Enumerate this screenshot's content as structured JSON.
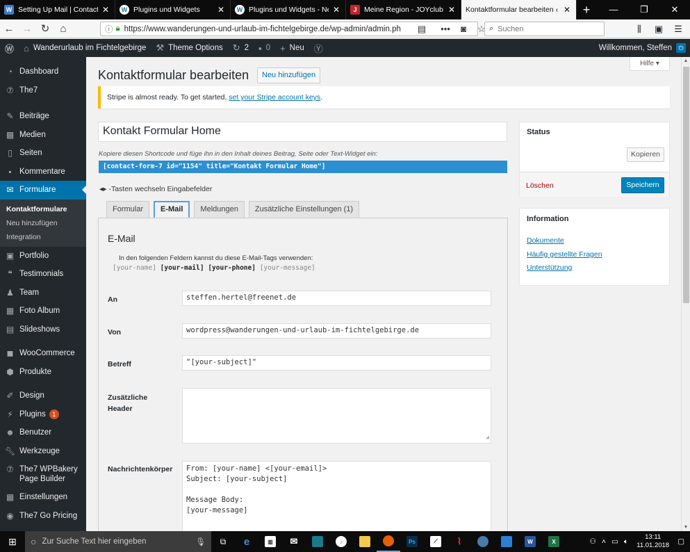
{
  "browser": {
    "tabs": [
      {
        "title": "Setting Up Mail | Contact For",
        "favicon_color": "#3d7cc9",
        "active": false
      },
      {
        "title": "Plugins und Widgets",
        "favicon_color": "#555555",
        "active": false
      },
      {
        "title": "Plugins und Widgets - Neues",
        "favicon_color": "#555555",
        "active": false
      },
      {
        "title": "Meine Region - JOYclub",
        "favicon_color": "#c0262d",
        "active": false
      },
      {
        "title": "Kontaktformular bearbeiten ‹ Wa",
        "favicon_color": "#555555",
        "active": true
      }
    ],
    "new_tab": "+",
    "url": "https://www.wanderungen-und-urlaub-im-fichtelgebirge.de/wp-admin/admin.ph",
    "search_placeholder": "Suchen"
  },
  "adminbar": {
    "site_name": "Wanderurlaub im Fichtelgebirge",
    "theme_options": "Theme Options",
    "updates_count": "2",
    "comments_count": "0",
    "new_label": "Neu",
    "greeting": "Willkommen, Steffen"
  },
  "sidebar": {
    "items": [
      {
        "label": "Dashboard",
        "icon": "dashboard-icon"
      },
      {
        "label": "The7",
        "icon": "the7-icon"
      },
      {
        "label": "Beiträge",
        "icon": "pin-icon"
      },
      {
        "label": "Medien",
        "icon": "media-icon"
      },
      {
        "label": "Seiten",
        "icon": "page-icon"
      },
      {
        "label": "Kommentare",
        "icon": "comment-icon"
      },
      {
        "label": "Formulare",
        "icon": "mail-icon"
      },
      {
        "label": "Portfolio",
        "icon": "portfolio-icon"
      },
      {
        "label": "Testimonials",
        "icon": "testimonial-icon"
      },
      {
        "label": "Team",
        "icon": "team-icon"
      },
      {
        "label": "Foto Album",
        "icon": "album-icon"
      },
      {
        "label": "Slideshows",
        "icon": "slideshow-icon"
      },
      {
        "label": "WooCommerce",
        "icon": "woocommerce-icon"
      },
      {
        "label": "Produkte",
        "icon": "product-icon"
      },
      {
        "label": "Design",
        "icon": "brush-icon"
      },
      {
        "label": "Plugins",
        "icon": "plugin-icon",
        "badge": "1"
      },
      {
        "label": "Benutzer",
        "icon": "user-icon"
      },
      {
        "label": "Werkzeuge",
        "icon": "wrench-icon"
      },
      {
        "label": "The7 WPBakery Page Builder",
        "icon": "builder-icon"
      },
      {
        "label": "Einstellungen",
        "icon": "settings-icon"
      },
      {
        "label": "The7 Go Pricing",
        "icon": "pricing-icon"
      }
    ],
    "submenu": [
      "Kontaktformulare",
      "Neu hinzufügen",
      "Integration"
    ]
  },
  "page": {
    "help": "Hilfe",
    "title": "Kontaktformular bearbeiten",
    "add_new": "Neu hinzufügen",
    "notice_text": "Stripe is almost ready. To get started, ",
    "notice_link": "set your Stripe account keys",
    "notice_end": ".",
    "form_title": "Kontakt Formular Home",
    "shortcode_label": "Kopiere diesen Shortcode und füge ihn in den Inhalt deines Beitrag, Seite oder Text-Widget ein:",
    "shortcode": "[contact-form-7 id=\"1154\" title=\"Kontakt Formular Home\"]",
    "tab_hint": "-Tasten wechseln Eingabefelder",
    "tabs": [
      "Formular",
      "E-Mail",
      "Meldungen",
      "Zusätzliche Einstellungen (1)"
    ],
    "mail": {
      "heading": "E-Mail",
      "intro": "In den folgenden Feldern kannst du diese E-Mail-Tags verwenden:",
      "tags": [
        "[your-name]",
        "[your-mail]",
        "[your-phone]",
        "[your-message]"
      ],
      "to_label": "An",
      "to_value": "steffen.hertel@freenet.de",
      "from_label": "Von",
      "from_value": "wordpress@wanderungen-und-urlaub-im-fichtelgebirge.de",
      "subject_label": "Betreff",
      "subject_value": "\"[your-subject]\"",
      "headers_label": "Zusätzliche Header",
      "headers_value": "",
      "body_label": "Nachrichtenkörper",
      "body_value": "From: [your-name] <[your-email]>\nSubject: [your-subject]\n\nMessage Body:\n[your-message]"
    }
  },
  "status_box": {
    "heading": "Status",
    "copy": "Kopieren",
    "delete": "Löschen",
    "save": "Speichern"
  },
  "info_box": {
    "heading": "Information",
    "links": [
      "Dokumente",
      "Häufig gestellte Fragen",
      "Unterstützung"
    ]
  },
  "taskbar": {
    "search_placeholder": "Zur Suche Text hier eingeben",
    "time": "13:11",
    "date": "11.01.2018"
  }
}
